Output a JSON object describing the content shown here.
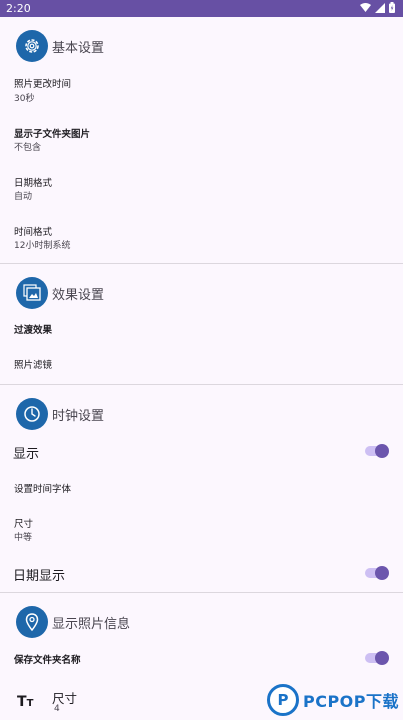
{
  "status_bar": {
    "time": "2:20"
  },
  "sections": {
    "basic": {
      "title": "基本设置",
      "items": [
        {
          "title": "照片更改时间",
          "value": "30秒"
        },
        {
          "title": "显示子文件夹图片",
          "value": "不包含"
        },
        {
          "title": "日期格式",
          "value": "自动"
        },
        {
          "title": "时间格式",
          "value": "12小时制系统"
        }
      ]
    },
    "effects": {
      "title": "效果设置",
      "items": [
        {
          "title": "过渡效果"
        },
        {
          "title": "照片滤镜"
        }
      ]
    },
    "clock": {
      "title": "时钟设置",
      "display_label": "显示",
      "display_on": true,
      "font_label": "设置时间字体",
      "size_label": "尺寸",
      "size_value": "中等",
      "date_label": "日期显示",
      "date_on": true
    },
    "photo_info": {
      "title": "显示照片信息",
      "folder_name_label": "保存文件夹名称",
      "folder_name_on": true,
      "size_label": "尺寸",
      "size_value": "4"
    }
  },
  "watermark": {
    "logo_letter": "P",
    "text": "PCPOP下载"
  },
  "colors": {
    "status_bar": "#6750a4",
    "accent": "#6c56ad",
    "icon_bg": "#1e67aa",
    "background": "#fcf7fe"
  }
}
